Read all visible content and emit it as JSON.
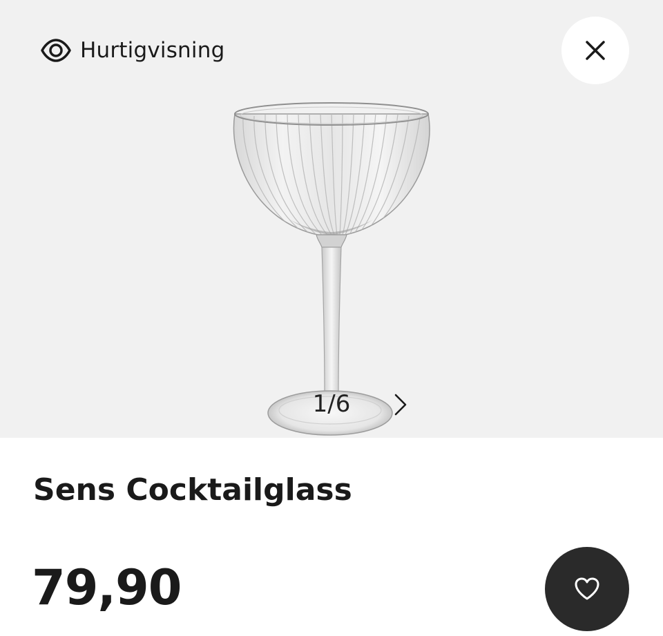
{
  "header": {
    "label": "Hurtigvisning",
    "icon": "eye-icon",
    "close_icon": "close-icon"
  },
  "gallery": {
    "current": "1/6",
    "next_icon": "chevron-right-icon",
    "image_subject": "cocktail-glass-image"
  },
  "product": {
    "title": "Sens Cocktailglass",
    "price": "79,90"
  },
  "actions": {
    "wishlist_icon": "heart-icon"
  },
  "colors": {
    "image_background": "#f1f1f1",
    "wishlist_button": "#2a2a2a",
    "text": "#1a1a1a"
  }
}
